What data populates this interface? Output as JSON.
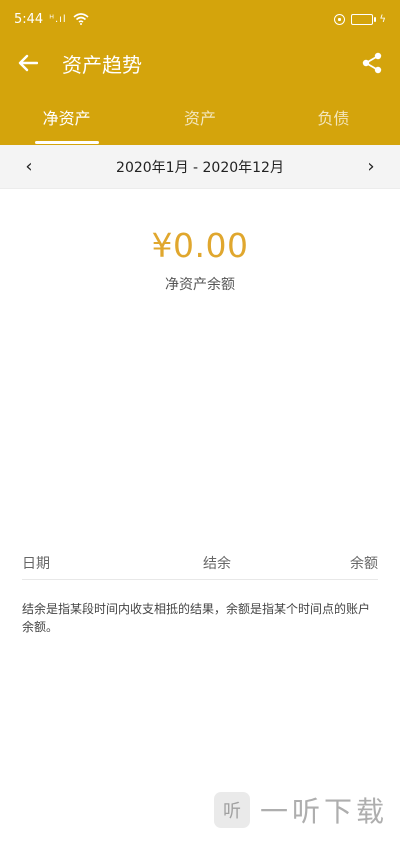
{
  "status_bar": {
    "time": "5:44",
    "signal_text": "ᴴ.ıl"
  },
  "header": {
    "title": "资产趋势",
    "back_icon": "arrow-left-icon",
    "share_icon": "share-icon"
  },
  "tabs": [
    {
      "label": "净资产",
      "active": true
    },
    {
      "label": "资产",
      "active": false
    },
    {
      "label": "负债",
      "active": false
    }
  ],
  "date_bar": {
    "range": "2020年1月 - 2020年12月",
    "prev": "‹",
    "next": "›"
  },
  "summary": {
    "amount": "¥0.00",
    "label": "净资产余额"
  },
  "table": {
    "columns": [
      "日期",
      "结余",
      "余额"
    ]
  },
  "note": "结余是指某段时间内收支相抵的结果，余额是指某个时间点的账户余额。",
  "watermark": {
    "logo": "听",
    "text": "一听下载"
  },
  "colors": {
    "primary": "#d4a40c",
    "amount": "#e0a72e",
    "battery": "#5fb3ff"
  }
}
